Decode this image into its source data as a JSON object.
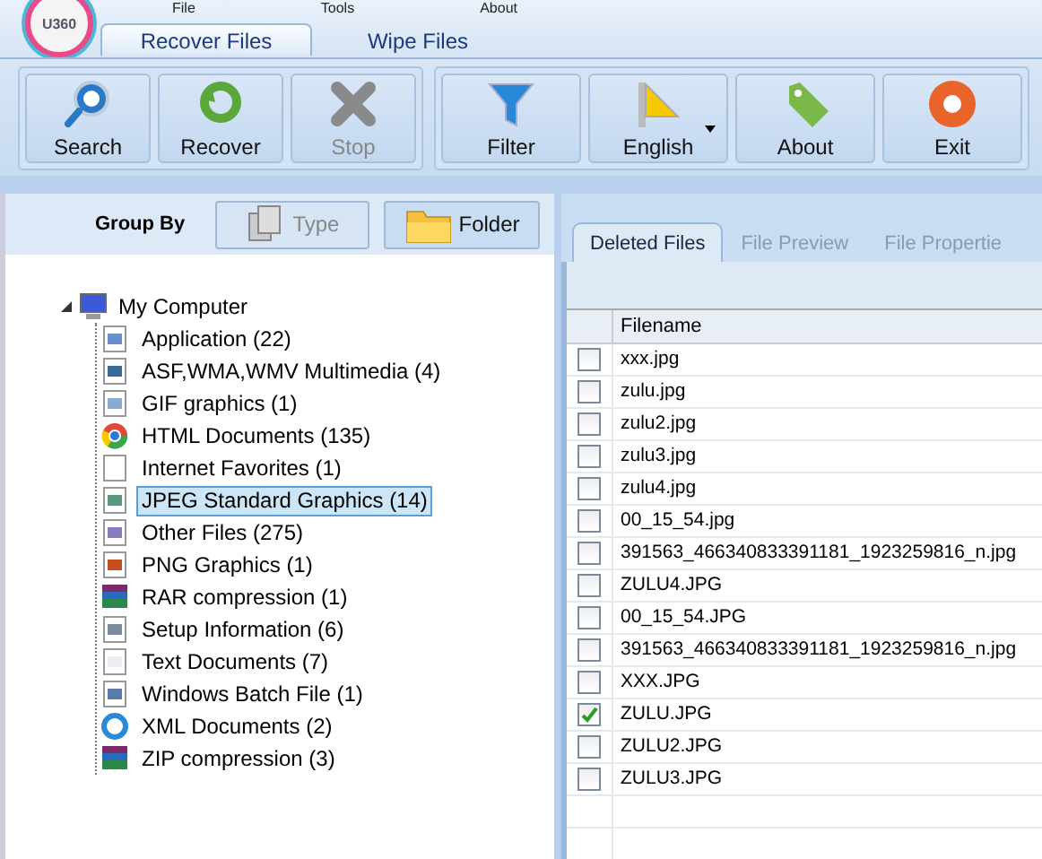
{
  "menu": [
    "File",
    "Tools",
    "About"
  ],
  "app_logo": {
    "text": "U360"
  },
  "tabs": [
    {
      "label": "Recover Files",
      "selected": true
    },
    {
      "label": "Wipe Files",
      "selected": false
    }
  ],
  "toolbar_groups": [
    [
      {
        "label": "Search",
        "kind": "search",
        "disabled": false
      },
      {
        "label": "Recover",
        "kind": "recover",
        "disabled": false
      },
      {
        "label": "Stop",
        "kind": "stop",
        "disabled": true
      }
    ],
    [
      {
        "label": "Filter",
        "kind": "filter",
        "disabled": false
      },
      {
        "label": "English",
        "kind": "language",
        "disabled": false,
        "dropdown": true
      },
      {
        "label": "About",
        "kind": "about",
        "disabled": false
      },
      {
        "label": "Exit",
        "kind": "exit",
        "disabled": false
      }
    ]
  ],
  "group_by": {
    "label": "Group By",
    "options": [
      {
        "label": "Type",
        "kind": "type",
        "selected": false
      },
      {
        "label": "Folder",
        "kind": "folder",
        "selected": true
      }
    ]
  },
  "tree": [
    {
      "label": "My Computer",
      "kind": "computer",
      "expanded": true,
      "selected": false,
      "children": [
        {
          "label": "Application (22)",
          "kind": "app",
          "selected": false
        },
        {
          "label": "ASF,WMA,WMV Multimedia (4)",
          "kind": "video",
          "selected": false
        },
        {
          "label": "GIF graphics (1)",
          "kind": "gif",
          "selected": false
        },
        {
          "label": "HTML Documents (135)",
          "kind": "browser",
          "selected": false
        },
        {
          "label": "Internet Favorites (1)",
          "kind": "blank",
          "selected": false
        },
        {
          "label": "JPEG Standard Graphics (14)",
          "kind": "image",
          "selected": true
        },
        {
          "label": "Other Files (275)",
          "kind": "other",
          "selected": false
        },
        {
          "label": "PNG Graphics (1)",
          "kind": "png",
          "selected": false
        },
        {
          "label": "RAR compression (1)",
          "kind": "archive",
          "selected": false
        },
        {
          "label": "Setup Information (6)",
          "kind": "setup",
          "selected": false
        },
        {
          "label": "Text Documents (7)",
          "kind": "text",
          "selected": false
        },
        {
          "label": "Windows Batch File (1)",
          "kind": "batch",
          "selected": false
        },
        {
          "label": "XML Documents (2)",
          "kind": "xml",
          "selected": false
        },
        {
          "label": "ZIP compression (3)",
          "kind": "archive",
          "selected": false
        }
      ]
    }
  ],
  "result_tabs": [
    {
      "label": "Deleted Files",
      "selected": true
    },
    {
      "label": "File Preview",
      "selected": false
    },
    {
      "label": "File Propertie",
      "selected": false
    }
  ],
  "table": {
    "columns": [
      "Filename"
    ],
    "rows": [
      {
        "filename": "xxx.jpg",
        "checked": false
      },
      {
        "filename": "zulu.jpg",
        "checked": false
      },
      {
        "filename": "zulu2.jpg",
        "checked": false
      },
      {
        "filename": "zulu3.jpg",
        "checked": false
      },
      {
        "filename": "zulu4.jpg",
        "checked": false
      },
      {
        "filename": "00_15_54.jpg",
        "checked": false
      },
      {
        "filename": "391563_466340833391181_1923259816_n.jpg",
        "checked": false
      },
      {
        "filename": "ZULU4.JPG",
        "checked": false
      },
      {
        "filename": "00_15_54.JPG",
        "checked": false
      },
      {
        "filename": "391563_466340833391181_1923259816_n.jpg",
        "checked": false
      },
      {
        "filename": "XXX.JPG",
        "checked": false
      },
      {
        "filename": "ZULU.JPG",
        "checked": true
      },
      {
        "filename": "ZULU2.JPG",
        "checked": false
      },
      {
        "filename": "ZULU3.JPG",
        "checked": false
      }
    ]
  }
}
